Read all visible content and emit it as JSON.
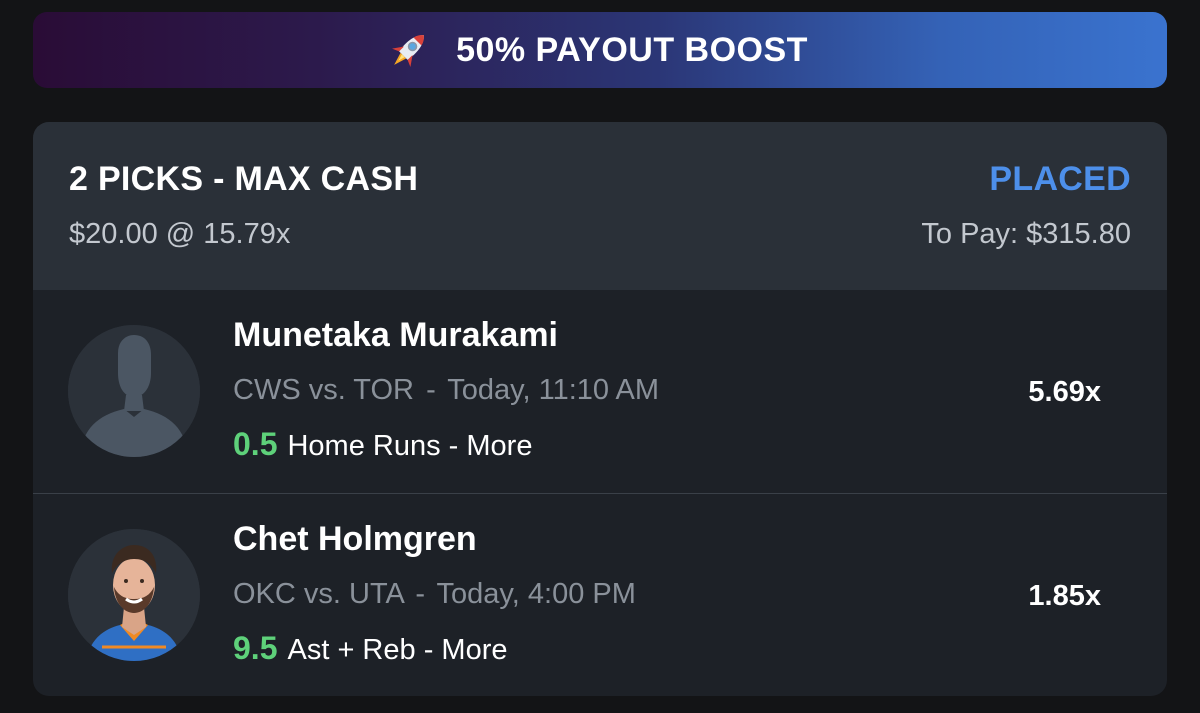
{
  "boost": {
    "icon": "rocket-icon",
    "label": "50% PAYOUT BOOST"
  },
  "entry": {
    "title": "2 PICKS - MAX CASH",
    "stake_line": "$20.00 @ 15.79x",
    "status": "PLACED",
    "to_pay": "To Pay: $315.80"
  },
  "picks": [
    {
      "player": "Munetaka Murakami",
      "matchup": "CWS vs. TOR",
      "sep": "-",
      "time": "Today, 11:10 AM",
      "line": "0.5",
      "stat": "Home Runs - More",
      "multiplier": "5.69x",
      "avatar": "placeholder-silhouette"
    },
    {
      "player": "Chet Holmgren",
      "matchup": "OKC vs. UTA",
      "sep": "-",
      "time": "Today, 4:00 PM",
      "line": "9.5",
      "stat": "Ast + Reb - More",
      "multiplier": "1.85x",
      "avatar": "player-headshot"
    }
  ],
  "colors": {
    "accent_blue": "#4d8fea",
    "line_green": "#5ed17a",
    "card_bg": "#1d2127",
    "header_bg": "#2a3038"
  }
}
